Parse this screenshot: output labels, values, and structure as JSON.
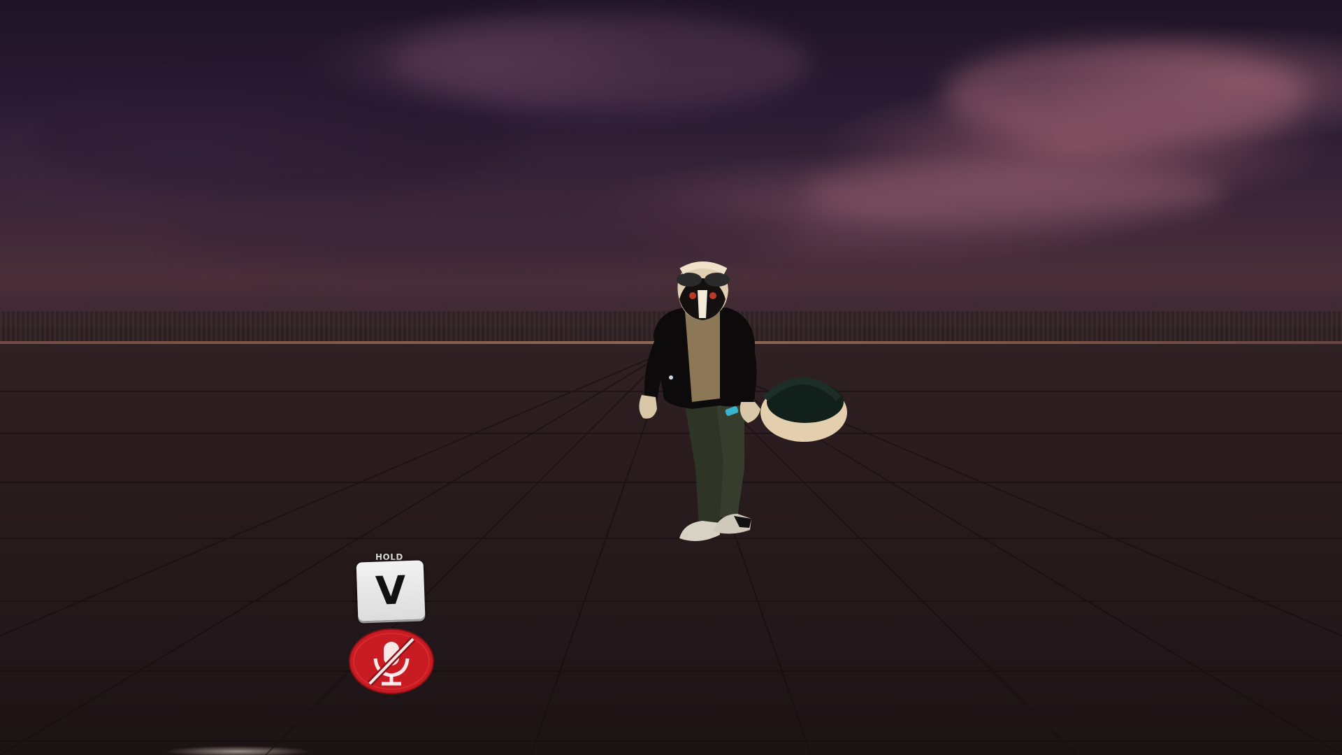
{
  "hud": {
    "push_to_talk": {
      "hold_label": "HOLD",
      "key_label": "V"
    },
    "mic_status": {
      "icon": "microphone-muted-icon",
      "state": "muted",
      "color": "#c81c22"
    }
  },
  "colors": {
    "sky_top": "#1e1326",
    "sky_horizon": "#4a2f38",
    "floor": "#2a1c1e"
  }
}
